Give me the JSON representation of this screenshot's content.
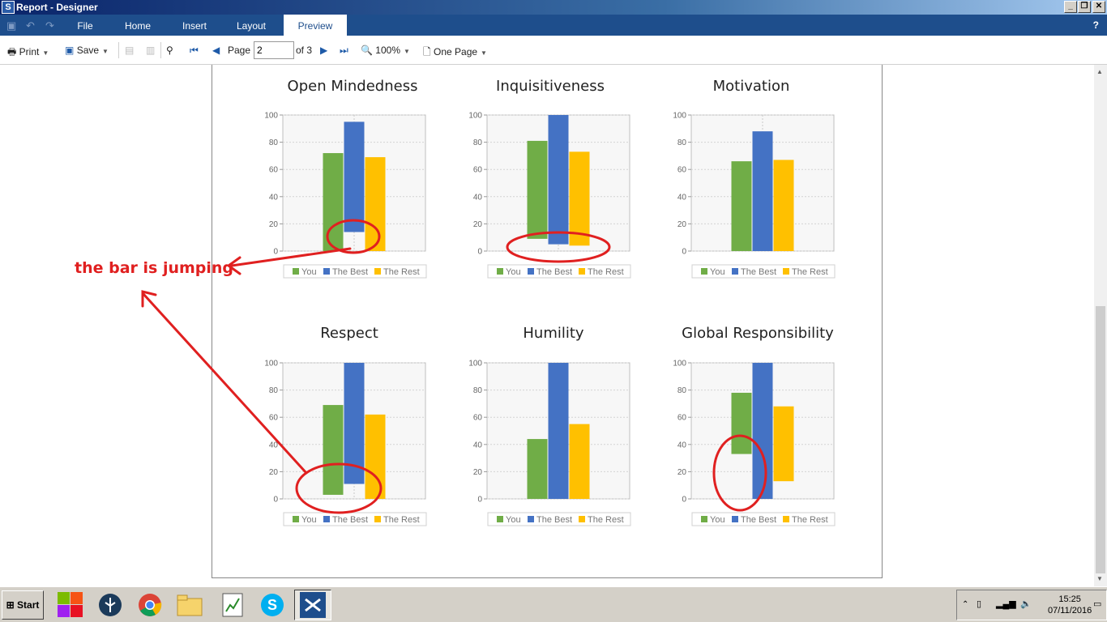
{
  "window": {
    "title": "Report - Designer"
  },
  "menu": {
    "tabs": [
      "File",
      "Home",
      "Insert",
      "Layout",
      "Preview"
    ],
    "active": "Preview",
    "help": "?"
  },
  "toolbar": {
    "print_label": "Print",
    "save_label": "Save",
    "page_label": "Page",
    "page_value": "2",
    "page_of": "of 3",
    "zoom_label": "100%",
    "view_label": "One Page"
  },
  "chart_data": [
    {
      "type": "bar",
      "title": "Open Mindedness",
      "ylim": [
        0,
        100
      ],
      "yticks": [
        0,
        20,
        40,
        60,
        80,
        100
      ],
      "series": [
        {
          "name": "You",
          "color": "#70ad47",
          "range": [
            0,
            72
          ]
        },
        {
          "name": "The Best",
          "color": "#4472c4",
          "range": [
            14,
            95
          ]
        },
        {
          "name": "The Rest",
          "color": "#ffc000",
          "range": [
            0,
            69
          ]
        }
      ]
    },
    {
      "type": "bar",
      "title": "Inquisitiveness",
      "ylim": [
        0,
        100
      ],
      "yticks": [
        0,
        20,
        40,
        60,
        80,
        100
      ],
      "series": [
        {
          "name": "You",
          "color": "#70ad47",
          "range": [
            9,
            81
          ]
        },
        {
          "name": "The Best",
          "color": "#4472c4",
          "range": [
            5,
            100
          ]
        },
        {
          "name": "The Rest",
          "color": "#ffc000",
          "range": [
            4,
            73
          ]
        }
      ]
    },
    {
      "type": "bar",
      "title": "Motivation",
      "ylim": [
        0,
        100
      ],
      "yticks": [
        0,
        20,
        40,
        60,
        80,
        100
      ],
      "series": [
        {
          "name": "You",
          "color": "#70ad47",
          "range": [
            0,
            66
          ]
        },
        {
          "name": "The Best",
          "color": "#4472c4",
          "range": [
            0,
            88
          ]
        },
        {
          "name": "The Rest",
          "color": "#ffc000",
          "range": [
            0,
            67
          ]
        }
      ]
    },
    {
      "type": "bar",
      "title": "Respect",
      "ylim": [
        0,
        100
      ],
      "yticks": [
        0,
        20,
        40,
        60,
        80,
        100
      ],
      "series": [
        {
          "name": "You",
          "color": "#70ad47",
          "range": [
            3,
            69
          ]
        },
        {
          "name": "The Best",
          "color": "#4472c4",
          "range": [
            11,
            100
          ]
        },
        {
          "name": "The Rest",
          "color": "#ffc000",
          "range": [
            0,
            62
          ]
        }
      ]
    },
    {
      "type": "bar",
      "title": "Humility",
      "ylim": [
        0,
        100
      ],
      "yticks": [
        0,
        20,
        40,
        60,
        80,
        100
      ],
      "series": [
        {
          "name": "You",
          "color": "#70ad47",
          "range": [
            0,
            44
          ]
        },
        {
          "name": "The Best",
          "color": "#4472c4",
          "range": [
            0,
            100
          ]
        },
        {
          "name": "The Rest",
          "color": "#ffc000",
          "range": [
            0,
            55
          ]
        }
      ]
    },
    {
      "type": "bar",
      "title": "Global Responsibility",
      "ylim": [
        0,
        100
      ],
      "yticks": [
        0,
        20,
        40,
        60,
        80,
        100
      ],
      "series": [
        {
          "name": "You",
          "color": "#70ad47",
          "range": [
            33,
            78
          ]
        },
        {
          "name": "The Best",
          "color": "#4472c4",
          "range": [
            0,
            100
          ]
        },
        {
          "name": "The Rest",
          "color": "#ffc000",
          "range": [
            13,
            68
          ]
        }
      ]
    }
  ],
  "annotation": {
    "text": "the bar is jumping",
    "color": "#e02020"
  },
  "taskbar": {
    "start_label": "Start",
    "time": "15:25",
    "date": "07/11/2016"
  }
}
